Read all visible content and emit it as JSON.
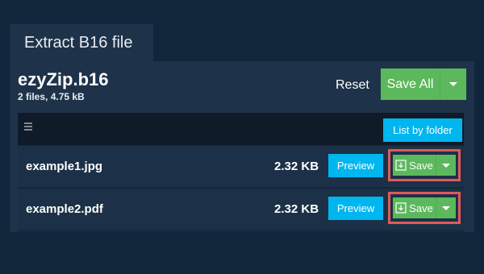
{
  "tab": {
    "title": "Extract B16 file"
  },
  "archive": {
    "name": "ezyZip.b16",
    "meta": "2 files, 4.75 kB"
  },
  "actions": {
    "reset_label": "Reset",
    "save_all_label": "Save All"
  },
  "toolbar": {
    "list_by_folder_label": "List by folder"
  },
  "files": [
    {
      "name": "example1.jpg",
      "size": "2.32 KB",
      "preview_label": "Preview",
      "save_label": "Save"
    },
    {
      "name": "example2.pdf",
      "size": "2.32 KB",
      "preview_label": "Preview",
      "save_label": "Save"
    }
  ],
  "colors": {
    "background": "#11253b",
    "panel": "#1e3349",
    "save_green": "#5cb85c",
    "preview_blue": "#00b6ef",
    "highlight_red": "#e05a5a"
  },
  "icons": [
    "menu-icon",
    "download-icon",
    "chevron-down-icon"
  ]
}
